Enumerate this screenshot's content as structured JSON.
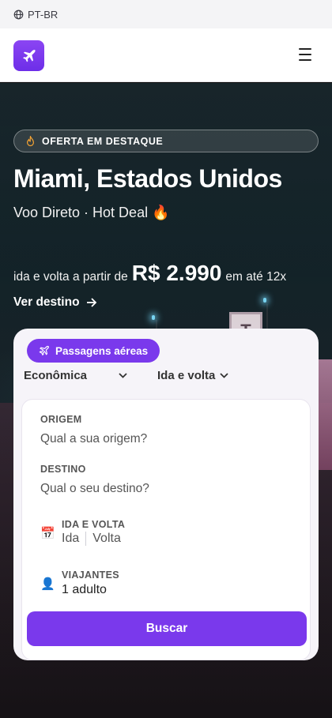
{
  "topbar": {
    "language": "PT-BR",
    "language_icon": "globe-icon"
  },
  "header": {
    "logo_icon": "plane-icon",
    "menu_icon": "hamburger-icon"
  },
  "hero": {
    "badge_icon": "flame-icon",
    "badge_text": "OFERTA EM DESTAQUE",
    "title": "Miami, Estados Unidos",
    "subtitle": "Voo Direto · Hot Deal 🔥",
    "price_prefix": "ida e volta a partir de",
    "price": "R$ 2.990",
    "price_suffix": "em até 12x",
    "cta_label": "Ver destino",
    "carousel": {
      "total_slides": 8,
      "active_slide": 3
    }
  },
  "search": {
    "tab_label": "Passagens aéreas",
    "cabin_class": "Econômica",
    "trip_type": "Ida e volta",
    "origin": {
      "label": "ORIGEM",
      "placeholder": "Qual a sua origem?"
    },
    "destination": {
      "label": "DESTINO",
      "placeholder": "Qual o seu destino?"
    },
    "dates": {
      "icon": "calendar-icon",
      "label": "IDA E VOLTA",
      "depart": "Ida",
      "return": "Volta"
    },
    "travelers": {
      "icon": "person-icon",
      "label": "VIAJANTES",
      "value": "1 adulto"
    },
    "submit_label": "Buscar"
  },
  "colors": {
    "brand_purple": "#7a39ec",
    "header_bg": "#ffffff",
    "langbar_bg": "#f4f4f6"
  }
}
